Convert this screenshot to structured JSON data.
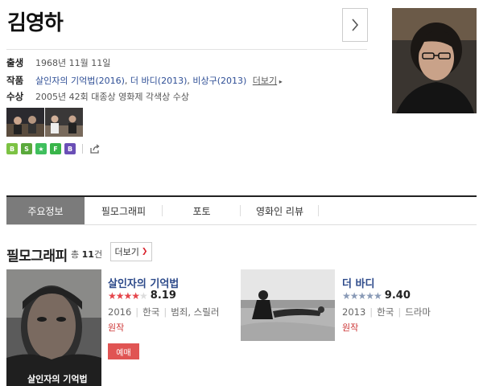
{
  "person": {
    "name": "김영하",
    "birth_label": "출생",
    "birth": "1968년 11월 11일",
    "works_label": "작품",
    "works": [
      "살인자의 기억법(2016)",
      "더 바디(2013)",
      "비상구(2013)"
    ],
    "works_sep": ", ",
    "works_more": "더보기",
    "award_label": "수상",
    "award": "2005년 42회 대종상 영화제 각색상 수상"
  },
  "share_icons": [
    {
      "name": "band-share-icon",
      "color": "#7cc243",
      "glyph": "B"
    },
    {
      "name": "kakaostory-share-icon",
      "color": "#5aa93b",
      "glyph": "S"
    },
    {
      "name": "twitter-share-icon",
      "color": "#3fbf5d",
      "glyph": "★"
    },
    {
      "name": "facebook-share-icon",
      "color": "#39b54a",
      "glyph": "F"
    },
    {
      "name": "blog-share-icon",
      "color": "#6a4fb6",
      "glyph": "B"
    }
  ],
  "tabs": [
    {
      "label": "주요정보",
      "active": true
    },
    {
      "label": "필모그래피",
      "active": false
    },
    {
      "label": "포토",
      "active": false
    },
    {
      "label": "영화인 리뷰",
      "active": false
    }
  ],
  "filmography": {
    "title": "필모그래피",
    "count_prefix": "총",
    "count": "11",
    "count_suffix": "건",
    "more": "더보기",
    "movies": [
      {
        "title": "살인자의 기억법",
        "stars_filled": 4,
        "stars_total": 5,
        "star_color": "#e5454b",
        "score": "8.19",
        "year": "2016",
        "country": "한국",
        "genre": "범죄, 스릴러",
        "role": "원작",
        "booking": "예매",
        "poster_caption": "살인자의 기억법"
      },
      {
        "title": "더 바디",
        "stars_filled": 5,
        "stars_total": 5,
        "star_color": "#8a9bb7",
        "score": "9.40",
        "year": "2013",
        "country": "한국",
        "genre": "드라마",
        "role": "원작"
      }
    ]
  }
}
